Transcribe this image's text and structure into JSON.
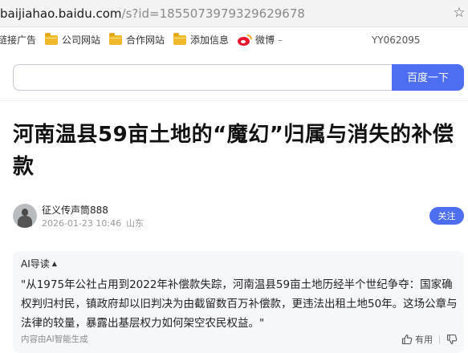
{
  "browser": {
    "url_host": "baijiahao.baidu.com",
    "url_path": "/s?id=1855073979329629678",
    "bookmark_icon": "star-icon"
  },
  "bookmarks": {
    "partial_item": "链接广告",
    "items": [
      {
        "label": "公司网站",
        "icon": "folder-icon"
      },
      {
        "label": "合作网站",
        "icon": "folder-icon"
      },
      {
        "label": "添加信息",
        "icon": "folder-icon"
      }
    ],
    "weibo": {
      "label": "微博",
      "suffix": "–",
      "icon": "weibo-icon"
    },
    "user_code": "YY062095"
  },
  "search": {
    "value": "",
    "button_label": "百度一下",
    "button_color": "#4e6ef2"
  },
  "article": {
    "title": "河南温县59亩土地的“魔幻”归属与消失的补偿款",
    "author": {
      "name": "征义传声筒888",
      "datetime": "2026-01-23 10:46",
      "location": "山东",
      "follow_label": "关注"
    }
  },
  "ai_summary": {
    "header": "AI导读",
    "caret": "▲",
    "text": "\"从1975年公社占用到2022年补偿款失踪，河南温县59亩土地历经半个世纪争夺：国家确权判归村民，镇政府却以旧判决为由截留数百万补偿款，更违法出租土地50年。这场公章与法律的较量，暴露出基层权力如何架空农民权益。\"",
    "footer": "内容由AI智能生成",
    "useful_label": "有用"
  }
}
